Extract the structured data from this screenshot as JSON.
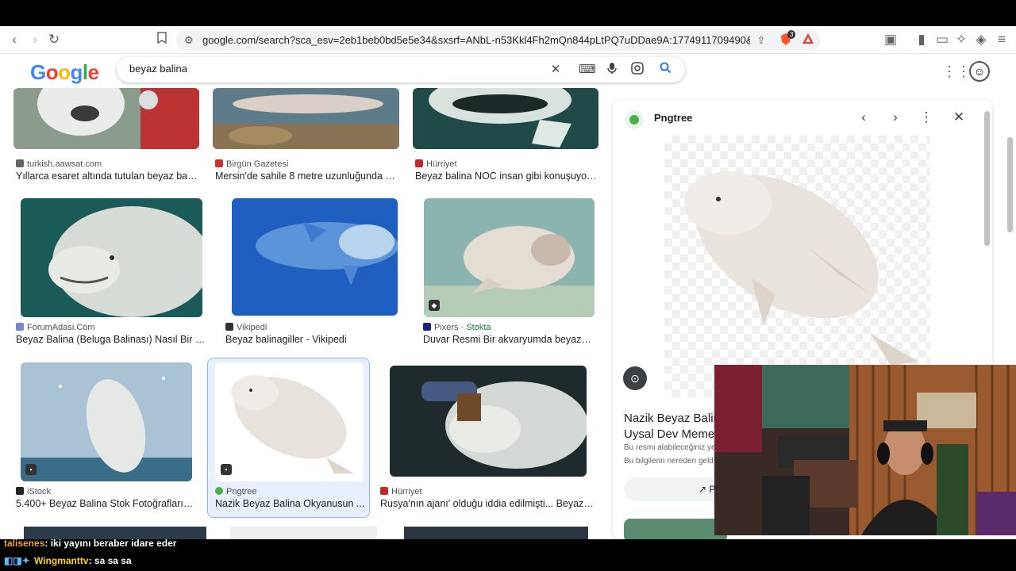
{
  "browser": {
    "url": "google.com/search?sca_esv=2eb1beb0bd5e5e34&sxsrf=ANbL-n53Kkl4Fh2mQn844pLtPQ7uDDae9A:1774911709490&udm=2&fbs...",
    "brave_badge": "3"
  },
  "google": {
    "logo_letters": [
      "G",
      "o",
      "o",
      "g",
      "l",
      "e"
    ],
    "search_query": "beyaz balina"
  },
  "results": [
    {
      "source": "turkish.aawsat.com",
      "title": "Yıllarca esaret altında tutulan beyaz bali...",
      "fav_color": "#5f6368"
    },
    {
      "source": "Birgün Gazetesi",
      "title": "Mersin'de sahile 8 metre uzunluğunda ol...",
      "fav_color": "#d32f2f"
    },
    {
      "source": "Hürriyet",
      "title": "Beyaz balina NOC insan gibi konuşuyor ...",
      "fav_color": "#c62828"
    },
    {
      "source": "ForumAdasi.Com",
      "title": "Beyaz Balina (Beluga Balinası) Nasıl Bir H...",
      "fav_color": "#7986cb"
    },
    {
      "source": "Vikipedi",
      "title": "Beyaz balinagiller - Vikipedi",
      "fav_color": "#333333"
    },
    {
      "source": "Pixers",
      "source_extra": "Stokta",
      "title": "Duvar Resmi Bir akvaryumda beyaz b...",
      "fav_color": "#1a237e"
    },
    {
      "source": "iStock",
      "title": "5.400+ Beyaz Balina Stok Fotoğrafları, ...",
      "fav_color": "#222222"
    },
    {
      "source": "Pngtree",
      "title": "Nazik Beyaz Balina Okyanusun ...",
      "fav_color": "#4caf50"
    },
    {
      "source": "Hürriyet",
      "title": "Rusya'nın ajanı' olduğu iddia edilmişti... Beyaz b...",
      "fav_color": "#c62828"
    }
  ],
  "panel": {
    "source": "Pngtree",
    "title_line1": "Nazik Beyaz Balin",
    "title_line2": "Uysal Dev Memel",
    "sub1": "Bu resmi alabileceğiniz ye",
    "sub2": "Bu bilgilerin nereden geld",
    "share_label": "Pay"
  },
  "chat": [
    {
      "user": "talisenes",
      "message": ": iki yayını beraber idare eder"
    },
    {
      "user": "Wingmanttv",
      "message": ": sa sa sa"
    }
  ],
  "icons": {
    "back": "back-arrow-icon",
    "forward": "forward-arrow-icon",
    "reload": "reload-icon",
    "bookmark": "bookmark-icon",
    "site-info": "site-info-icon",
    "share": "share-icon",
    "brave": "brave-shield-icon",
    "clear": "close-icon",
    "keyboard": "keyboard-icon",
    "mic": "microphone-icon",
    "lens": "lens-icon",
    "search": "search-icon"
  }
}
